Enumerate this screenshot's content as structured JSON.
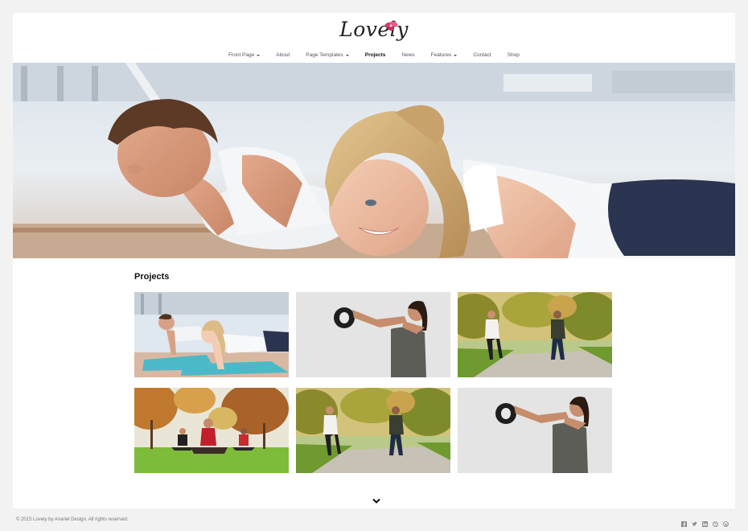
{
  "site": {
    "logo_text": "Lovely"
  },
  "nav": {
    "items": [
      {
        "label": "Front Page",
        "has_caret": true
      },
      {
        "label": "About",
        "has_caret": false
      },
      {
        "label": "Page Templates",
        "has_caret": true
      },
      {
        "label": "Projects",
        "has_caret": false,
        "active": true
      },
      {
        "label": "News",
        "has_caret": false
      },
      {
        "label": "Features",
        "has_caret": true
      },
      {
        "label": "Contact",
        "has_caret": false
      },
      {
        "label": "Shop",
        "has_caret": false
      }
    ]
  },
  "section": {
    "title": "Projects"
  },
  "projects": [
    {
      "icon": "pushups-photo"
    },
    {
      "icon": "kettlebell-photo"
    },
    {
      "icon": "running-park-photo"
    },
    {
      "icon": "yoga-park-photo"
    },
    {
      "icon": "running-park-photo"
    },
    {
      "icon": "kettlebell-photo"
    }
  ],
  "footer": {
    "copyright": "© 2015 Lovely by Anariel Design. All rights reserved.",
    "social_icons": [
      "facebook-icon",
      "twitter-icon",
      "linkedin-icon",
      "dribbble-icon",
      "wordpress-icon"
    ]
  },
  "colors": {
    "accent": "#d43f6e",
    "page_bg": "#f2f2f2",
    "card_bg": "#ffffff"
  }
}
